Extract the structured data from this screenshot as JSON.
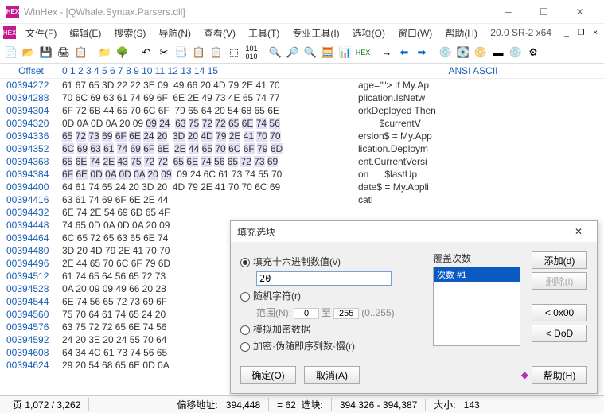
{
  "window": {
    "title": "WinHex - [QWhale.Syntax.Parsers.dll]",
    "version": "20.0 SR-2 x64"
  },
  "menu": [
    "文件(F)",
    "编辑(E)",
    "搜索(S)",
    "导航(N)",
    "查看(V)",
    "工具(T)",
    "专业工具(I)",
    "选项(O)",
    "窗口(W)",
    "帮助(H)"
  ],
  "header": {
    "offset": "Offset",
    "cols": " 0  1  2  3  4  5  6  7   8  9 10 11 12 13 14 15",
    "ascii": "ANSI ASCII"
  },
  "rows": [
    {
      "o": "00394272",
      "h": "61 67 65 3D 22 22 3E 09  49 66 20 4D 79 2E 41 70",
      "a": "age=\"\"> If My.Ap",
      "sel": []
    },
    {
      "o": "00394288",
      "h": "70 6C 69 63 61 74 69 6F  6E 2E 49 73 4E 65 74 77",
      "a": "plication.IsNetw",
      "sel": []
    },
    {
      "o": "00394304",
      "h": "6F 72 6B 44 65 70 6C 6F  79 65 64 20 54 68 65 6E",
      "a": "orkDeployed Then",
      "sel": []
    },
    {
      "o": "00394320",
      "h": "0D 0A 0D 0A 20 09 09 24  63 75 72 72 65 6E 74 56",
      "a": "        $currentV",
      "sel": [
        6,
        15
      ]
    },
    {
      "o": "00394336",
      "h": "65 72 73 69 6F 6E 24 20  3D 20 4D 79 2E 41 70 70",
      "a": "ersion$ = My.App",
      "sel": [
        0,
        15
      ]
    },
    {
      "o": "00394352",
      "h": "6C 69 63 61 74 69 6F 6E  2E 44 65 70 6C 6F 79 6D",
      "a": "lication.Deploym",
      "sel": [
        0,
        15
      ]
    },
    {
      "o": "00394368",
      "h": "65 6E 74 2E 43 75 72 72  65 6E 74 56 65 72 73 69",
      "a": "ent.CurrentVersi",
      "sel": [
        0,
        15
      ]
    },
    {
      "o": "00394384",
      "h": "6F 6E 0D 0A 0D 0A 20 09  09 24 6C 61 73 74 55 70",
      "a": "on      $lastUp",
      "sel": [
        0,
        7
      ]
    },
    {
      "o": "00394400",
      "h": "64 61 74 65 24 20 3D 20  4D 79 2E 41 70 70 6C 69",
      "a": "date$ = My.Appli",
      "sel": []
    },
    {
      "o": "00394416",
      "h": "63 61 74 69 6F 6E 2E 44",
      "a": "cati",
      "sel": []
    },
    {
      "o": "00394432",
      "h": "6E 74 2E 54 69 6D 65 4F",
      "a": "",
      "sel": []
    },
    {
      "o": "00394448",
      "h": "74 65 0D 0A 0D 0A 20 09",
      "a": "",
      "sel": []
    },
    {
      "o": "00394464",
      "h": "6C 65 72 65 63 65 6E 74",
      "a": "",
      "sel": []
    },
    {
      "o": "00394480",
      "h": "3D 20 4D 79 2E 41 70 70",
      "a": "",
      "sel": []
    },
    {
      "o": "00394496",
      "h": "2E 44 65 70 6C 6F 79 6D",
      "a": "",
      "sel": []
    },
    {
      "o": "00394512",
      "h": "61 74 65 64 56 65 72 73",
      "a": "",
      "sel": []
    },
    {
      "o": "00394528",
      "h": "0A 20 09 09 49 66 20 28",
      "a": "",
      "sel": []
    },
    {
      "o": "00394544",
      "h": "6E 74 56 65 72 73 69 6F",
      "a": "",
      "sel": []
    },
    {
      "o": "00394560",
      "h": "75 70 64 61 74 65 24 20",
      "a": "",
      "sel": []
    },
    {
      "o": "00394576",
      "h": "63 75 72 72 65 6E 74 56",
      "a": "",
      "sel": []
    },
    {
      "o": "00394592",
      "h": "24 20 3E 20 24 55 70 64",
      "a": "",
      "sel": []
    },
    {
      "o": "00394608",
      "h": "64 34 4C 61 73 74 56 65",
      "a": "",
      "sel": []
    },
    {
      "o": "00394624",
      "h": "29 20 54 68 65 6E 0D 0A",
      "a": "",
      "sel": []
    }
  ],
  "status": {
    "page": "页 1,072 / 3,262",
    "offlab": "偏移地址:",
    "off": "394,448",
    "sellab": "选块:",
    "sel": "= 62",
    "range": "394,326 - 394,387",
    "sizelab": "大小:",
    "size": "143"
  },
  "dialog": {
    "title": "填充选块",
    "opt_hex": "填充十六进制数值(v)",
    "hexval": "20",
    "opt_rand": "随机字符(r)",
    "range_lab": "范围(N):",
    "r0": "0",
    "to": "至",
    "r1": "255",
    "hint": "(0..255)",
    "opt_sim": "模拟加密数据",
    "opt_enc": "加密·伪随即序列数·慢(r)",
    "overwrite": "覆盖次数",
    "item": "次数 #1",
    "add": "添加(d)",
    "del": "删除(l)",
    "zero": "< 0x00",
    "dod": "< DoD",
    "ok": "确定(O)",
    "cancel": "取消(A)",
    "help": "帮助(H)"
  }
}
